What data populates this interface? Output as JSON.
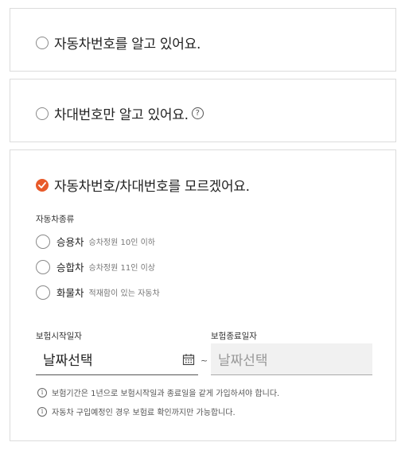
{
  "options": {
    "car_number": {
      "label": "자동차번호를 알고 있어요."
    },
    "vin_number": {
      "label": "차대번호만 알고 있어요.",
      "help_icon": "question-circle-icon",
      "help_glyph": "?"
    },
    "unknown": {
      "label": "자동차번호/차대번호를 모르겠어요."
    }
  },
  "vehicle_type": {
    "section_label": "자동차종류",
    "items": [
      {
        "name": "승용차",
        "desc": "승차정원 10인 이하"
      },
      {
        "name": "승합차",
        "desc": "승차정원 11인 이상"
      },
      {
        "name": "화물차",
        "desc": "적재함이 있는 자동차"
      }
    ]
  },
  "dates": {
    "start_label": "보험시작일자",
    "end_label": "보험종료일자",
    "start_value": "날짜선택",
    "end_value": "날짜선택",
    "separator": "~"
  },
  "notes": [
    {
      "icon_glyph": "i",
      "text": "보험기간은 1년으로 보험시작일과 종료일을 같게 가입하셔야 합니다."
    },
    {
      "icon_glyph": "i",
      "text": "자동차 구입예정인 경우 보험료 확인까지만 가능합니다."
    }
  ],
  "colors": {
    "accent": "#e85a2a",
    "border": "#dcdcdc",
    "disabled_bg": "#f1f1f1"
  }
}
